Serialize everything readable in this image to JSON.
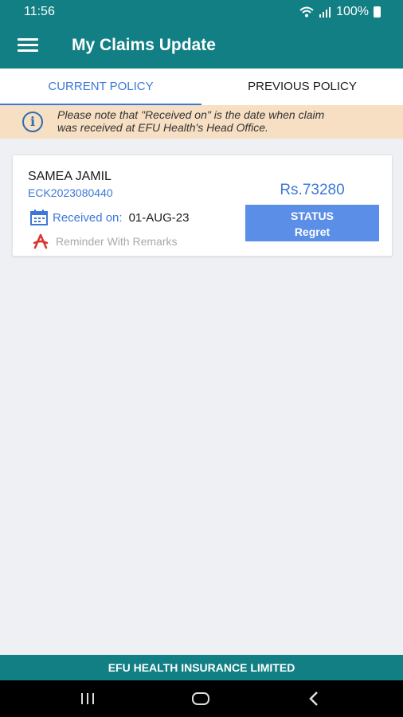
{
  "status_bar": {
    "time": "11:56",
    "battery": "100%"
  },
  "app_bar": {
    "title": "My Claims Update",
    "menu_icon": "hamburger-menu-icon"
  },
  "tabs": [
    {
      "label": "CURRENT POLICY",
      "active": true
    },
    {
      "label": "PREVIOUS POLICY",
      "active": false
    }
  ],
  "notice": {
    "line1": "Please note that \"Received on\" is the date when claim",
    "line2": "was received at EFU Health's Head Office.",
    "icon": "info-icon"
  },
  "claims": [
    {
      "name": "SAMEA JAMIL",
      "claim_no": "ECK2023080440",
      "received_label": "Received on:",
      "received_date": "01-AUG-23",
      "reminder_label": "Reminder With Remarks",
      "amount": "Rs.73280",
      "status_label": "STATUS",
      "status_value": "Regret"
    }
  ],
  "footer": {
    "company": "EFU HEALTH INSURANCE LIMITED"
  },
  "colors": {
    "primary": "#127f84",
    "accent": "#3b78d8",
    "status_button": "#5b8ee6",
    "notice_bg": "#f6dfc2"
  }
}
